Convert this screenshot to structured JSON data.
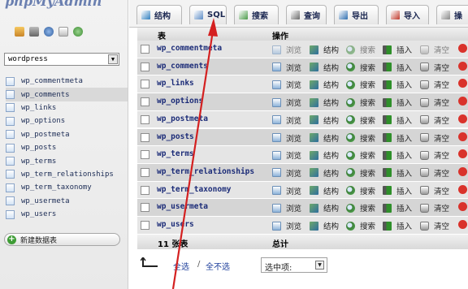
{
  "logo": {
    "text": "phpMyAdmin"
  },
  "nav_icons": [
    "home-icon",
    "logout-icon",
    "help-icon",
    "docs-icon",
    "reload-icon"
  ],
  "database_select": {
    "value": "wordpress"
  },
  "sidebar": {
    "tables": [
      "wp_commentmeta",
      "wp_comments",
      "wp_links",
      "wp_options",
      "wp_postmeta",
      "wp_posts",
      "wp_terms",
      "wp_term_relationships",
      "wp_term_taxonomy",
      "wp_usermeta",
      "wp_users"
    ],
    "active_index": 1,
    "new_db_label": "新建数据表"
  },
  "tabs": [
    {
      "label": "结构",
      "icon": "structure-icon"
    },
    {
      "label": "SQL",
      "icon": "sql-icon"
    },
    {
      "label": "搜索",
      "icon": "search-icon"
    },
    {
      "label": "查询",
      "icon": "query-icon"
    },
    {
      "label": "导出",
      "icon": "export-icon"
    },
    {
      "label": "导入",
      "icon": "import-icon"
    },
    {
      "label": "操",
      "icon": "operations-icon"
    }
  ],
  "table": {
    "header": {
      "name": "表",
      "operations": "操作"
    },
    "actions": {
      "browse": "浏览",
      "structure": "结构",
      "search": "搜索",
      "insert": "插入",
      "empty": "清空"
    },
    "rows": [
      {
        "name": "wp_commentmeta",
        "muted": true
      },
      {
        "name": "wp_comments",
        "muted": false
      },
      {
        "name": "wp_links",
        "muted": false
      },
      {
        "name": "wp_options",
        "muted": false
      },
      {
        "name": "wp_postmeta",
        "muted": false
      },
      {
        "name": "wp_posts",
        "muted": false
      },
      {
        "name": "wp_terms",
        "muted": false
      },
      {
        "name": "wp_term_relationships",
        "muted": false
      },
      {
        "name": "wp_term_taxonomy",
        "muted": false
      },
      {
        "name": "wp_usermeta",
        "muted": false
      },
      {
        "name": "wp_users",
        "muted": false
      }
    ],
    "summary": {
      "count": "11 张表",
      "total": "总计"
    }
  },
  "bottom": {
    "select_all": "全选",
    "separator": "/",
    "unselect_all": "全不选",
    "with_selected": "选中项:"
  },
  "colors": {
    "annotation_arrow": "#d42020",
    "table_name": "#1c2c78",
    "row_odd": "#e5e5e5",
    "row_even": "#d5d5d5"
  }
}
